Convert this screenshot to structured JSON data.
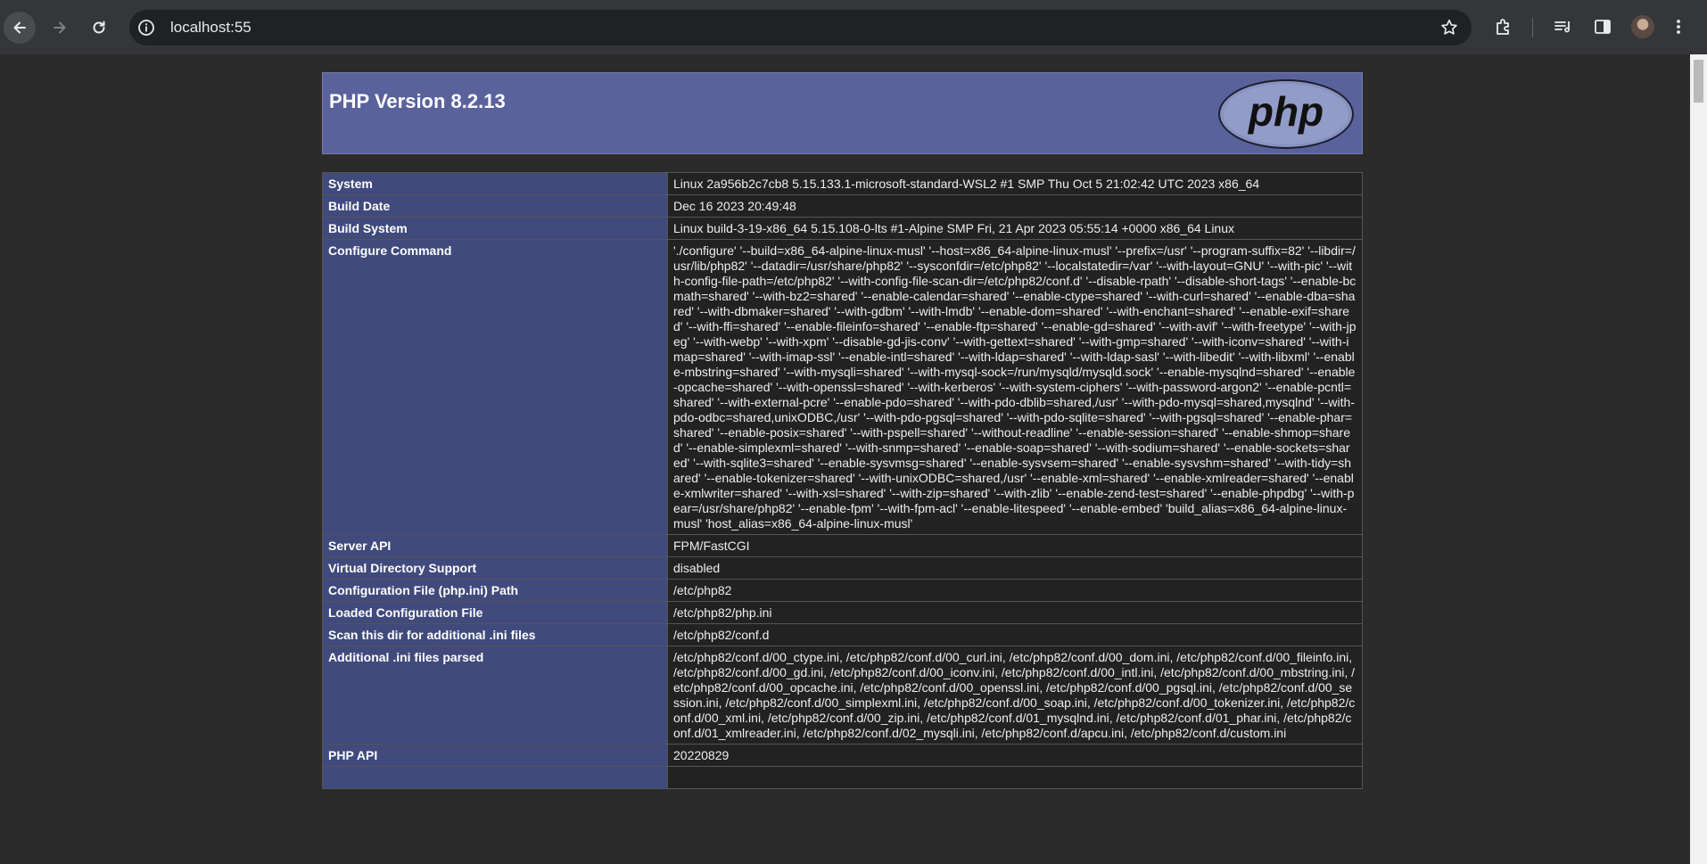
{
  "browser": {
    "url": "localhost:55"
  },
  "phpinfo": {
    "title": "PHP Version 8.2.13",
    "logo_text": "php",
    "rows": [
      {
        "key": "System",
        "value": "Linux 2a956b2c7cb8 5.15.133.1-microsoft-standard-WSL2 #1 SMP Thu Oct 5 21:02:42 UTC 2023 x86_64"
      },
      {
        "key": "Build Date",
        "value": "Dec 16 2023 20:49:48"
      },
      {
        "key": "Build System",
        "value": "Linux build-3-19-x86_64 5.15.108-0-lts #1-Alpine SMP Fri, 21 Apr 2023 05:55:14 +0000 x86_64 Linux"
      },
      {
        "key": "Configure Command",
        "value": "'./configure' '--build=x86_64-alpine-linux-musl' '--host=x86_64-alpine-linux-musl' '--prefix=/usr' '--program-suffix=82' '--libdir=/usr/lib/php82' '--datadir=/usr/share/php82' '--sysconfdir=/etc/php82' '--localstatedir=/var' '--with-layout=GNU' '--with-pic' '--with-config-file-path=/etc/php82' '--with-config-file-scan-dir=/etc/php82/conf.d' '--disable-rpath' '--disable-short-tags' '--enable-bcmath=shared' '--with-bz2=shared' '--enable-calendar=shared' '--enable-ctype=shared' '--with-curl=shared' '--enable-dba=shared' '--with-dbmaker=shared' '--with-gdbm' '--with-lmdb' '--enable-dom=shared' '--with-enchant=shared' '--enable-exif=shared' '--with-ffi=shared' '--enable-fileinfo=shared' '--enable-ftp=shared' '--enable-gd=shared' '--with-avif' '--with-freetype' '--with-jpeg' '--with-webp' '--with-xpm' '--disable-gd-jis-conv' '--with-gettext=shared' '--with-gmp=shared' '--with-iconv=shared' '--with-imap=shared' '--with-imap-ssl' '--enable-intl=shared' '--with-ldap=shared' '--with-ldap-sasl' '--with-libedit' '--with-libxml' '--enable-mbstring=shared' '--with-mysqli=shared' '--with-mysql-sock=/run/mysqld/mysqld.sock' '--enable-mysqlnd=shared' '--enable-opcache=shared' '--with-openssl=shared' '--with-kerberos' '--with-system-ciphers' '--with-password-argon2' '--enable-pcntl=shared' '--with-external-pcre' '--enable-pdo=shared' '--with-pdo-dblib=shared,/usr' '--with-pdo-mysql=shared,mysqlnd' '--with-pdo-odbc=shared,unixODBC,/usr' '--with-pdo-pgsql=shared' '--with-pdo-sqlite=shared' '--with-pgsql=shared' '--enable-phar=shared' '--enable-posix=shared' '--with-pspell=shared' '--without-readline' '--enable-session=shared' '--enable-shmop=shared' '--enable-simplexml=shared' '--with-snmp=shared' '--enable-soap=shared' '--with-sodium=shared' '--enable-sockets=shared' '--with-sqlite3=shared' '--enable-sysvmsg=shared' '--enable-sysvsem=shared' '--enable-sysvshm=shared' '--with-tidy=shared' '--enable-tokenizer=shared' '--with-unixODBC=shared,/usr' '--enable-xml=shared' '--enable-xmlreader=shared' '--enable-xmlwriter=shared' '--with-xsl=shared' '--with-zip=shared' '--with-zlib' '--enable-zend-test=shared' '--enable-phpdbg' '--with-pear=/usr/share/php82' '--enable-fpm' '--with-fpm-acl' '--enable-litespeed' '--enable-embed' 'build_alias=x86_64-alpine-linux-musl' 'host_alias=x86_64-alpine-linux-musl'"
      },
      {
        "key": "Server API",
        "value": "FPM/FastCGI"
      },
      {
        "key": "Virtual Directory Support",
        "value": "disabled"
      },
      {
        "key": "Configuration File (php.ini) Path",
        "value": "/etc/php82"
      },
      {
        "key": "Loaded Configuration File",
        "value": "/etc/php82/php.ini"
      },
      {
        "key": "Scan this dir for additional .ini files",
        "value": "/etc/php82/conf.d"
      },
      {
        "key": "Additional .ini files parsed",
        "value": "/etc/php82/conf.d/00_ctype.ini, /etc/php82/conf.d/00_curl.ini, /etc/php82/conf.d/00_dom.ini, /etc/php82/conf.d/00_fileinfo.ini, /etc/php82/conf.d/00_gd.ini, /etc/php82/conf.d/00_iconv.ini, /etc/php82/conf.d/00_intl.ini, /etc/php82/conf.d/00_mbstring.ini, /etc/php82/conf.d/00_opcache.ini, /etc/php82/conf.d/00_openssl.ini, /etc/php82/conf.d/00_pgsql.ini, /etc/php82/conf.d/00_session.ini, /etc/php82/conf.d/00_simplexml.ini, /etc/php82/conf.d/00_soap.ini, /etc/php82/conf.d/00_tokenizer.ini, /etc/php82/conf.d/00_xml.ini, /etc/php82/conf.d/00_zip.ini, /etc/php82/conf.d/01_mysqlnd.ini, /etc/php82/conf.d/01_phar.ini, /etc/php82/conf.d/01_xmlreader.ini, /etc/php82/conf.d/02_mysqli.ini, /etc/php82/conf.d/apcu.ini, /etc/php82/conf.d/custom.ini"
      },
      {
        "key": "PHP API",
        "value": "20220829"
      },
      {
        "key": "",
        "value": ""
      }
    ]
  }
}
